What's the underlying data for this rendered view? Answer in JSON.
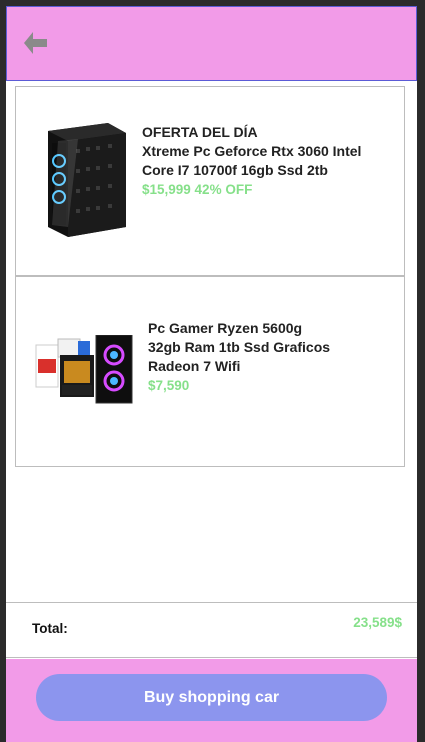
{
  "header": {
    "back_icon": "arrow-left-icon"
  },
  "cart": {
    "items": [
      {
        "lines": [
          "OFERTA DEL DÍA",
          "Xtreme Pc Geforce Rtx 3060 Intel",
          "Core I7 10700f 16gb Ssd 2tb"
        ],
        "price": "$15,999 42% OFF",
        "image": "gaming-pc-tower-image"
      },
      {
        "lines": [
          "Pc Gamer Ryzen 5600g",
          "32gb Ram 1tb Ssd Graficos",
          "Radeon 7 Wifi"
        ],
        "price": "$7,590",
        "image": "pc-components-bundle-image"
      }
    ]
  },
  "summary": {
    "total_label": "Total:",
    "total_value": "23,589$"
  },
  "footer": {
    "buy_label": "Buy shopping car"
  },
  "colors": {
    "header_bg": "#f29be8",
    "button_bg": "#8c95ee",
    "price_green": "#86e08a"
  }
}
